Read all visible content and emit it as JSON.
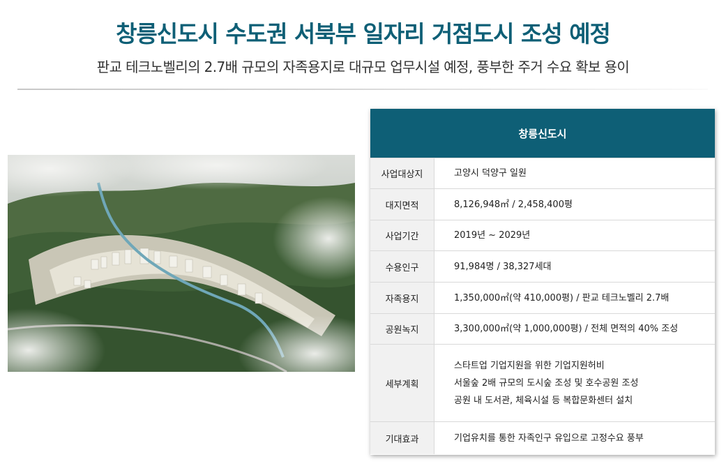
{
  "headline": "창릉신도시 수도권 서북부 일자리 거점도시 조성 예정",
  "subline": "판교 테크노벨리의 2.7배 규모의 자족용지로 대규모 업무시설 예정, 풍부한 주거 수요 확보 용이",
  "photo": {
    "description_icon": "aerial-photo"
  },
  "table": {
    "header": "창릉신도시",
    "rows": [
      {
        "label": "사업대상지",
        "lines": [
          "고양시 덕양구 일원"
        ]
      },
      {
        "label": "대지면적",
        "lines": [
          "8,126,948㎡ / 2,458,400평"
        ]
      },
      {
        "label": "사업기간",
        "lines": [
          "2019년 ~ 2029년"
        ]
      },
      {
        "label": "수용인구",
        "lines": [
          "91,984명 / 38,327세대"
        ]
      },
      {
        "label": "자족용지",
        "lines": [
          "1,350,000㎡(약 410,000평) / 판교 테크노벨리 2.7배"
        ]
      },
      {
        "label": "공원녹지",
        "lines": [
          "3,300,000㎡(약 1,000,000평) / 전체 면적의 40% 조성"
        ]
      },
      {
        "label": "세부계획",
        "lines": [
          "스타트업 기업지원을 위한 기업지원허비",
          "서울숲 2배 규모의 도시숲 조성 및 호수공원 조성",
          "공원 내 도서관, 체육시설 등 복합문화센터 설치"
        ]
      },
      {
        "label": "기대효과",
        "lines": [
          "기업유치를 통한 자족인구 유입으로 고정수요 풍부"
        ]
      }
    ]
  },
  "colors": {
    "accent": "#0e5f76",
    "label_bg": "#f1f1f1"
  }
}
